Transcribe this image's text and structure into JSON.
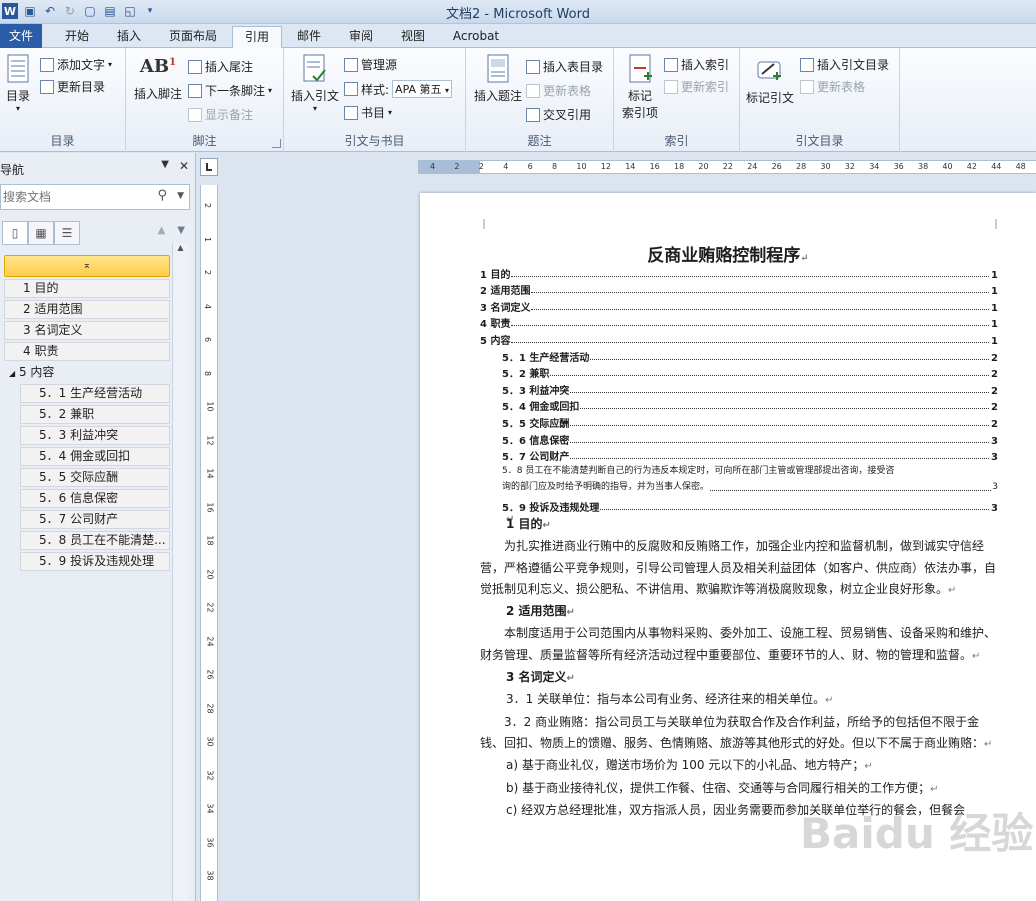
{
  "window": {
    "title": "文档2 - Microsoft Word",
    "app_logo": "W"
  },
  "tabs": [
    {
      "label": "文件"
    },
    {
      "label": "开始"
    },
    {
      "label": "插入"
    },
    {
      "label": "页面布局"
    },
    {
      "label": "引用"
    },
    {
      "label": "邮件"
    },
    {
      "label": "审阅"
    },
    {
      "label": "视图"
    },
    {
      "label": "Acrobat"
    }
  ],
  "ribbon": {
    "toc_group": {
      "label": "目录",
      "toc_button": "目录",
      "add_text": "添加文字",
      "update_toc": "更新目录"
    },
    "footnote_group": {
      "label": "脚注",
      "insert_footnote": "插入脚注",
      "insert_endnote": "插入尾注",
      "next_footnote": "下一条脚注",
      "show_notes": "显示备注",
      "ab_icon": "AB"
    },
    "citation_group": {
      "label": "引文与书目",
      "insert_citation": "插入引文",
      "manage_sources": "管理源",
      "style_label": "样式:",
      "style_value": "APA 第五",
      "bibliography": "书目"
    },
    "caption_group": {
      "label": "题注",
      "insert_caption": "插入题注",
      "insert_table_of_figures": "插入表目录",
      "update_table": "更新表格",
      "cross_reference": "交叉引用"
    },
    "index_group": {
      "label": "索引",
      "mark_entry_line1": "标记",
      "mark_entry_line2": "索引项",
      "insert_index": "插入索引",
      "update_index": "更新索引"
    },
    "toa_group": {
      "label": "引文目录",
      "mark_citation": "标记引文",
      "insert_toa": "插入引文目录",
      "update_table": "更新表格"
    }
  },
  "nav": {
    "title": "导航",
    "search_placeholder": "搜索文档",
    "top_marker": "⌅",
    "items": [
      {
        "label": "1 目的",
        "level": 1
      },
      {
        "label": "2 适用范围",
        "level": 1
      },
      {
        "label": "3 名词定义",
        "level": 1
      },
      {
        "label": "4 职责",
        "level": 1
      },
      {
        "label": "5 内容",
        "level": 0
      },
      {
        "label": "5．1 生产经营活动",
        "level": 2
      },
      {
        "label": "5．2 兼职",
        "level": 2
      },
      {
        "label": "5．3 利益冲突",
        "level": 2
      },
      {
        "label": "5．4 佣金或回扣",
        "level": 2
      },
      {
        "label": "5．5 交际应酬",
        "level": 2
      },
      {
        "label": "5．6 信息保密",
        "level": 2
      },
      {
        "label": "5．7 公司财产",
        "level": 2
      },
      {
        "label": "5．8 员工在不能清楚...",
        "level": 2
      },
      {
        "label": "5．9 投诉及违规处理",
        "level": 2
      }
    ]
  },
  "rulers": {
    "h_ticks": [
      "4",
      "2",
      "2",
      "4",
      "6",
      "8",
      "10",
      "12",
      "14",
      "16",
      "18",
      "20",
      "22",
      "24",
      "26",
      "28",
      "30",
      "32",
      "34",
      "36",
      "38",
      "40",
      "42",
      "44",
      "48"
    ],
    "v_ticks": [
      "2",
      "1",
      "2",
      "4",
      "6",
      "8",
      "10",
      "12",
      "14",
      "16",
      "18",
      "20",
      "22",
      "24",
      "26",
      "28",
      "30",
      "32",
      "34",
      "36",
      "38"
    ]
  },
  "document": {
    "title": "反商业贿赂控制程序",
    "toc": [
      {
        "label": "1  目的",
        "page": "1",
        "sub": false
      },
      {
        "label": "2  适用范围",
        "page": "1",
        "sub": false
      },
      {
        "label": "3  名词定义",
        "page": "1",
        "sub": false
      },
      {
        "label": "4  职责",
        "page": "1",
        "sub": false
      },
      {
        "label": "5  内容",
        "page": "1",
        "sub": false
      },
      {
        "label": "5．1 生产经营活动",
        "page": "2",
        "sub": true
      },
      {
        "label": "5．2 兼职",
        "page": "2",
        "sub": true
      },
      {
        "label": "5．3 利益冲突",
        "page": "2",
        "sub": true
      },
      {
        "label": "5．4 佣金或回扣",
        "page": "2",
        "sub": true
      },
      {
        "label": "5．5 交际应酬",
        "page": "2",
        "sub": true
      },
      {
        "label": "5．6 信息保密",
        "page": "3",
        "sub": true
      },
      {
        "label": "5．7 公司财产",
        "page": "3",
        "sub": true
      }
    ],
    "toc_long_line1": "5．8 员工在不能清楚判断自己的行为违反本规定时，可向所在部门主管或管理部提出咨询，接受咨",
    "toc_long_line2": "询的部门应及时给予明确的指导，并为当事人保密。",
    "toc_long_page": "3",
    "toc_last": {
      "label": "5．9 投诉及违规处理",
      "page": "3"
    },
    "h1": "1  目的",
    "p1": "为扎实推进商业行贿中的反腐败和反贿赂工作，加强企业内控和监督机制，做到诚实守信经营，严格遵循公平竞争规则，引导公司管理人员及相关利益团体（如客户、供应商）依法办事，自觉抵制见利忘义、损公肥私、不讲信用、欺骗欺诈等消极腐败现象，树立企业良好形象。",
    "h2": "2  适用范围",
    "p2": "本制度适用于公司范围内从事物料采购、委外加工、设施工程、贸易销售、设备采购和维护、财务管理、质量监督等所有经济活动过程中重要部位、重要环节的人、财、物的管理和监督。",
    "h3": "3  名词定义",
    "p3_1": "3．1 关联单位：指与本公司有业务、经济往来的相关单位。",
    "p3_2": "3．2 商业贿赂：指公司员工与关联单位为获取合作及合作利益，所给予的包括但不限于金钱、回扣、物质上的馈赠、服务、色情贿赂、旅游等其他形式的好处。但以下不属于商业贿赂：",
    "p3_a": "a) 基于商业礼仪，赠送市场价为 100 元以下的小礼品、地方特产；",
    "p3_b": "b) 基于商业接待礼仪，提供工作餐、住宿、交通等与合同履行相关的工作方便；",
    "p3_c": "c) 经双方总经理批准，双方指派人员，因业务需要而参加关联单位举行的餐会，但餐会"
  },
  "watermark": "Baidu 经验"
}
